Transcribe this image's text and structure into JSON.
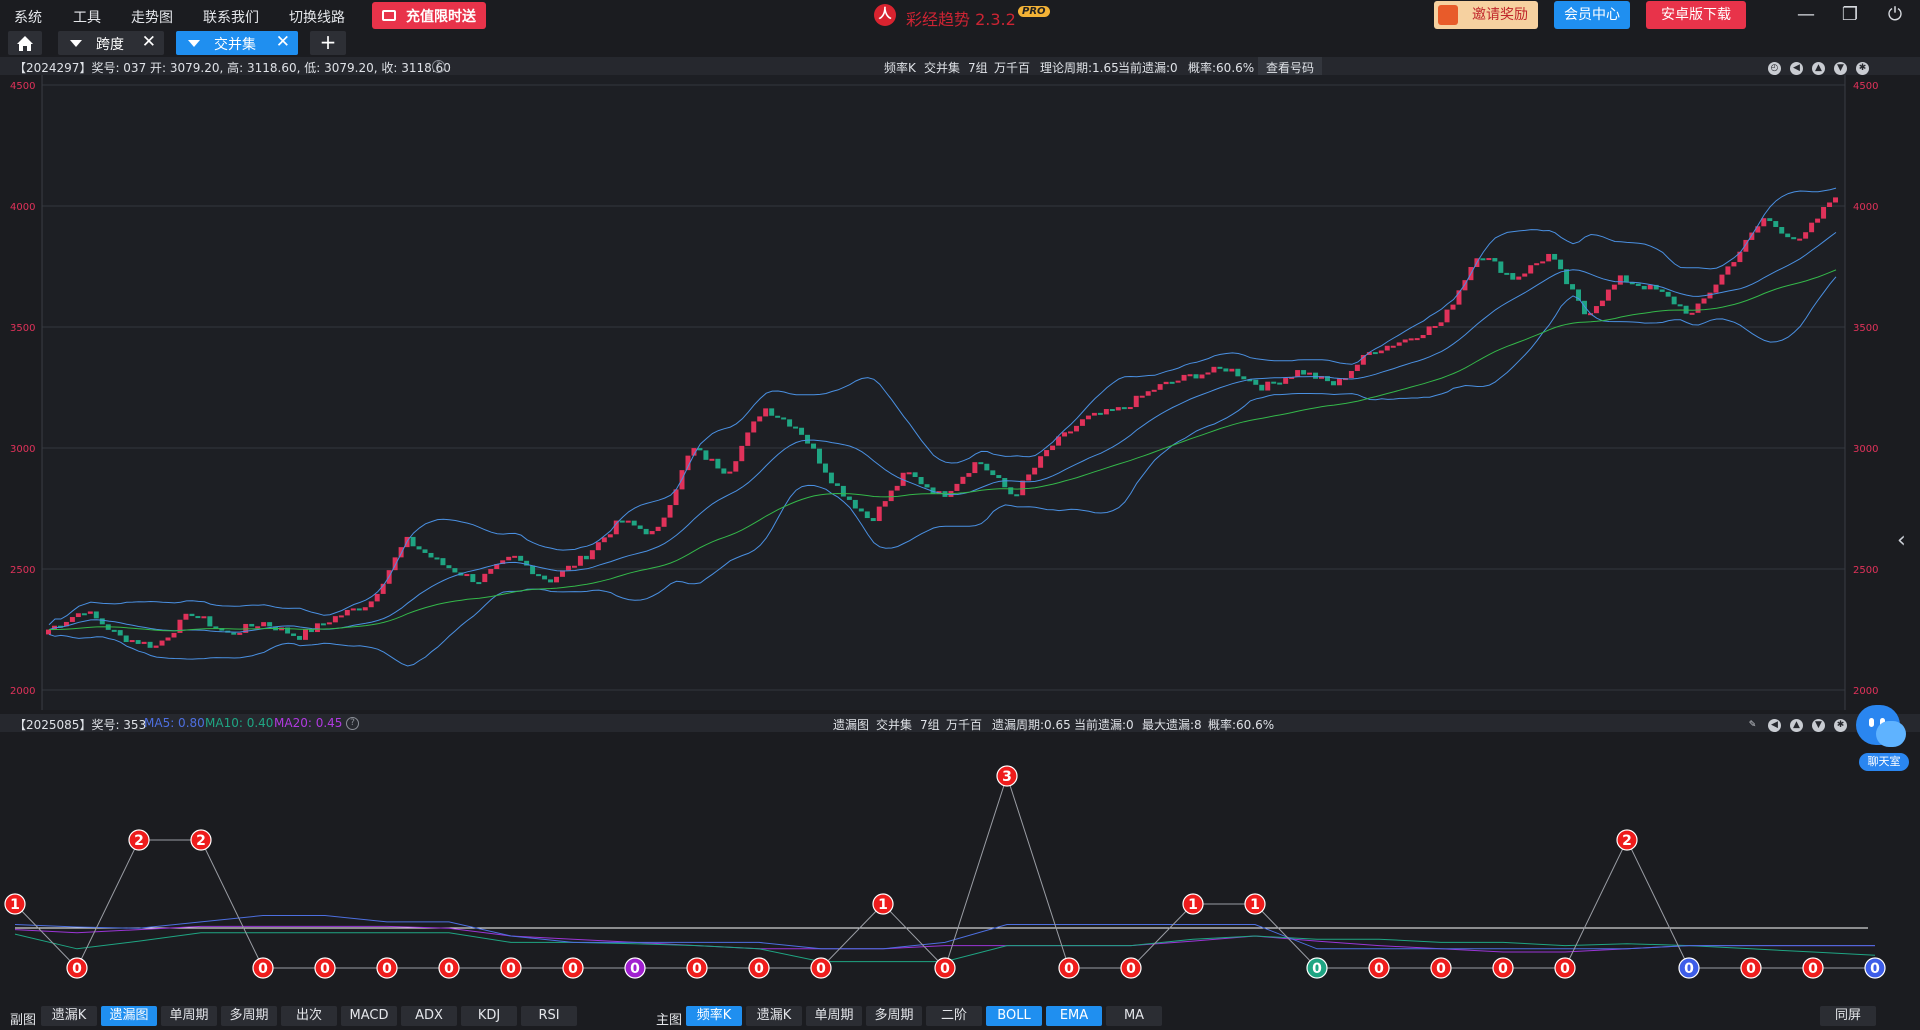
{
  "menu": [
    "系统",
    "工具",
    "走势图",
    "联系我们",
    "切换线路"
  ],
  "promo": {
    "label": "充值限时送"
  },
  "brand": {
    "name": "彩经趋势 2.3.2",
    "badge": "PRO"
  },
  "top_buttons": {
    "invite": "邀请奖励",
    "member": "会员中心",
    "android": "安卓版下载"
  },
  "window_controls": {
    "minimize": "—",
    "restore": "❐",
    "power": "⏻"
  },
  "tabs": [
    {
      "label": "跨度",
      "active": false
    },
    {
      "label": "交并集",
      "active": true
    }
  ],
  "add_tab": "+",
  "main_panel": {
    "info": "【2024297】奖号: 037   开: 3079.20, 高: 3118.60, 低: 3079.20, 收: 3118.60",
    "help": "?",
    "settings": [
      "频率K",
      "交并集",
      "7组",
      "万千百",
      "理论周期:1.65",
      "当前遗漏:0",
      "概率:60.6%"
    ],
    "view_numbers": "查看号码",
    "y_ticks": [
      "4500",
      "4000",
      "3500",
      "3000",
      "2500",
      "2000"
    ]
  },
  "sub_panel": {
    "period": "【2025085】奖号: 353",
    "ma5": "MA5: 0.80",
    "ma10": "MA10: 0.40",
    "ma20": "MA20: 0.45",
    "help": "?",
    "settings": [
      "遗漏图",
      "交并集",
      "7组",
      "万千百",
      "遗漏周期:0.65",
      "当前遗漏:0",
      "最大遗漏:8",
      "概率:60.6%"
    ]
  },
  "chart_data": [
    {
      "type": "candlestick",
      "title": "频率K",
      "ylim": [
        2000,
        4500
      ],
      "y_ticks": [
        2000,
        2500,
        3000,
        3500,
        4000,
        4500
      ],
      "overlays": [
        "BOLL",
        "EMA"
      ],
      "last_candle": {
        "open": 3079.2,
        "high": 3118.6,
        "low": 3079.2,
        "close": 3118.6
      },
      "close_path_approx": [
        2250,
        2330,
        2220,
        2180,
        2320,
        2230,
        2280,
        2220,
        2300,
        2360,
        2620,
        2520,
        2450,
        2550,
        2450,
        2550,
        2700,
        2640,
        3000,
        2900,
        3170,
        3080,
        2850,
        2700,
        2900,
        2800,
        2950,
        2800,
        3000,
        3120,
        3160,
        3250,
        3300,
        3330,
        3250,
        3320,
        3260,
        3400,
        3450,
        3520,
        3810,
        3700,
        3800,
        3550,
        3700,
        3650,
        3550,
        3750,
        3950,
        3850,
        4050
      ]
    },
    {
      "type": "line",
      "title": "遗漏图",
      "series": [
        {
          "name": "遗漏",
          "values": [
            1,
            0,
            2,
            2,
            0,
            0,
            0,
            0,
            0,
            0,
            0,
            0,
            0,
            0,
            1,
            0,
            3,
            0,
            0,
            1,
            1,
            0,
            0,
            0,
            0,
            0,
            2,
            0,
            0,
            0,
            0
          ]
        },
        {
          "name": "MA5",
          "values": [
            0.8
          ]
        },
        {
          "name": "MA10",
          "values": [
            0.4
          ]
        },
        {
          "name": "MA20",
          "values": [
            0.45
          ]
        }
      ]
    }
  ],
  "bottom": {
    "sub_label": "副图",
    "sub_buttons": [
      {
        "label": "遗漏K",
        "on": false
      },
      {
        "label": "遗漏图",
        "on": true
      },
      {
        "label": "单周期",
        "on": false
      },
      {
        "label": "多周期",
        "on": false
      },
      {
        "label": "出次",
        "on": false
      },
      {
        "label": "MACD",
        "on": false
      },
      {
        "label": "ADX",
        "on": false
      },
      {
        "label": "KDJ",
        "on": false
      },
      {
        "label": "RSI",
        "on": false
      }
    ],
    "main_label": "主图",
    "main_buttons": [
      {
        "label": "频率K",
        "on": true
      },
      {
        "label": "遗漏K",
        "on": false
      },
      {
        "label": "单周期",
        "on": false
      },
      {
        "label": "多周期",
        "on": false
      },
      {
        "label": "二阶",
        "on": false
      },
      {
        "label": "BOLL",
        "on": true
      },
      {
        "label": "EMA",
        "on": true
      },
      {
        "label": "MA",
        "on": false
      }
    ],
    "sync_screen": "同屏"
  },
  "chat": {
    "label": "聊天室"
  },
  "collapse": "‹",
  "colors": {
    "up": "#e0325a",
    "down": "#1fa583",
    "boll": "#4a90e2",
    "ema": "#34b84a",
    "accent": "#1f8ff0",
    "red_button": "#e8334a"
  }
}
